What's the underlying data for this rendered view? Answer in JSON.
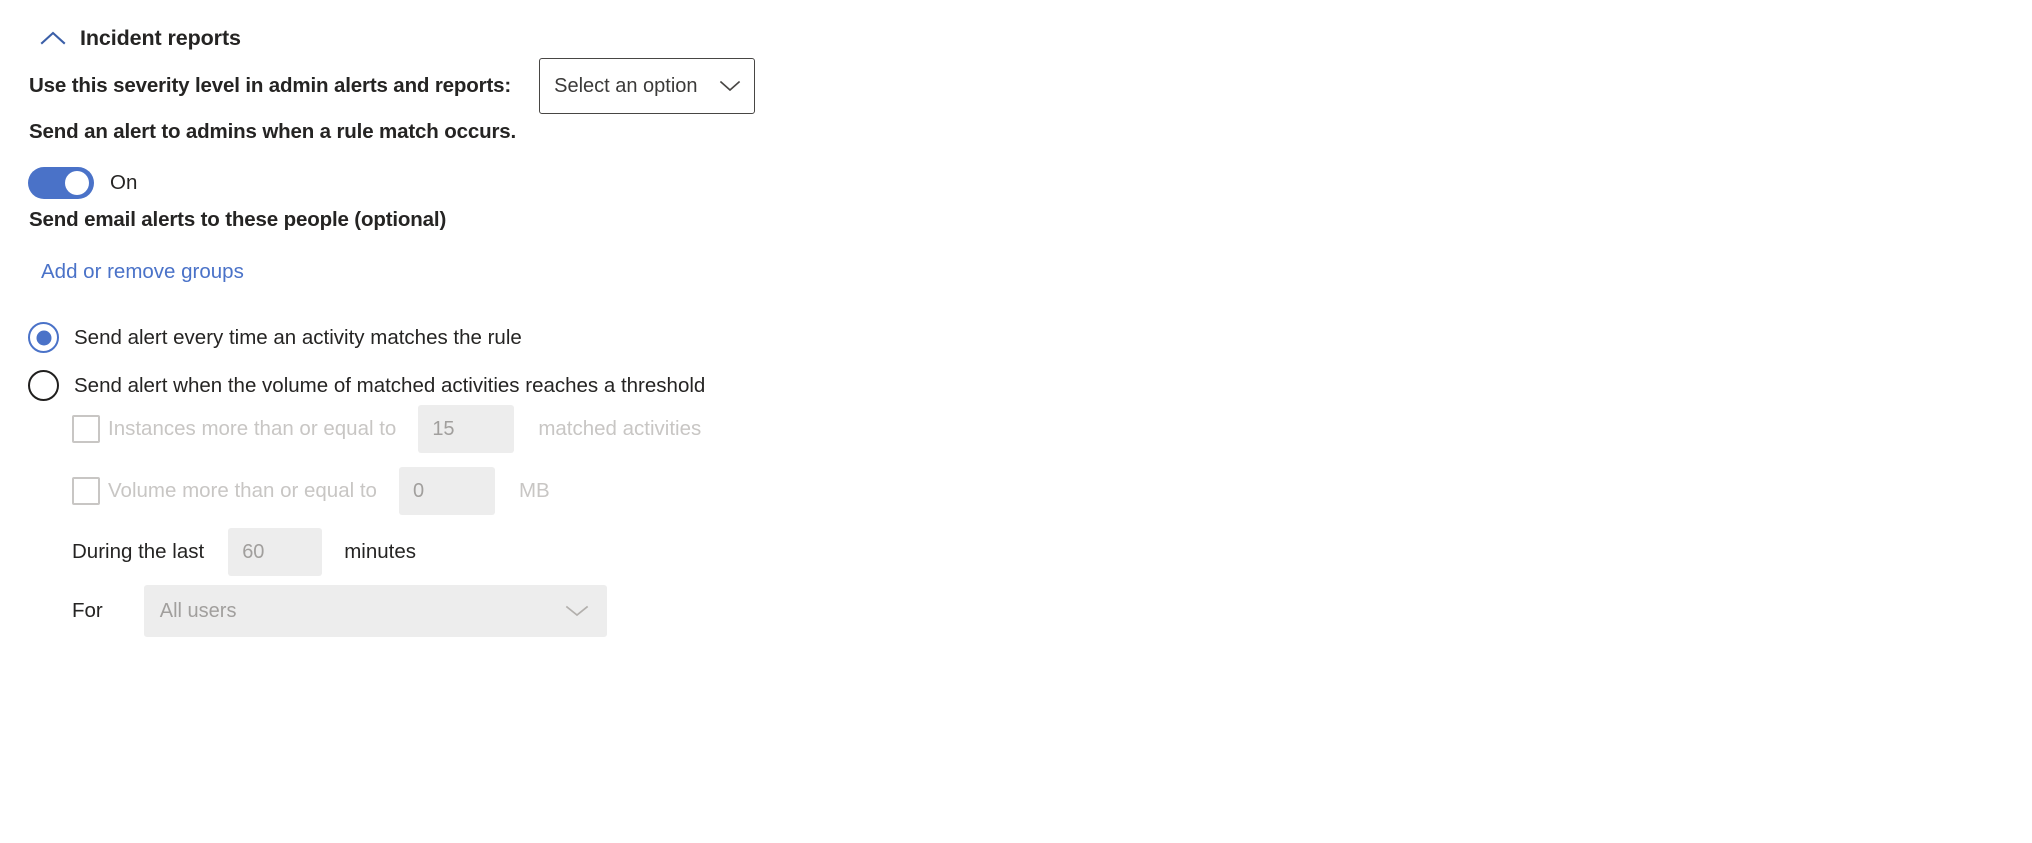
{
  "section": {
    "title": "Incident reports",
    "collapse_icon": "chevron-up-icon"
  },
  "severity": {
    "label": "Use this severity level in admin alerts and reports:",
    "dropdown_value": "Select an option",
    "caret_icon": "chevron-down-icon"
  },
  "admin_alert": {
    "label": "Send an alert to admins when a rule match occurs.",
    "toggle_state": "On"
  },
  "email_alerts": {
    "label": "Send email alerts to these people (optional)",
    "link_text": "Add or remove groups",
    "link_color": "#4a72c8"
  },
  "alert_mode": {
    "options": [
      {
        "label": "Send alert every time an activity matches the rule",
        "selected": true
      },
      {
        "label": "Send alert when the volume of matched activities reaches a threshold",
        "selected": false
      }
    ]
  },
  "threshold": {
    "instances": {
      "checkbox_label": "Instances more than or equal to",
      "value": "15",
      "unit": "matched activities",
      "checked": false,
      "disabled": true
    },
    "volume": {
      "checkbox_label": "Volume more than or equal to",
      "value": "0",
      "unit": "MB",
      "checked": false,
      "disabled": true
    },
    "duration": {
      "prefix_label": "During the last",
      "value": "60",
      "unit": "minutes"
    },
    "scope": {
      "prefix_label": "For",
      "value": "All users",
      "caret_icon": "chevron-down-icon"
    }
  },
  "colors": {
    "accent_blue": "#4a72c8",
    "text_primary": "#252423",
    "text_disabled": "#c8c6c4",
    "input_disabled_bg": "#ededed"
  }
}
